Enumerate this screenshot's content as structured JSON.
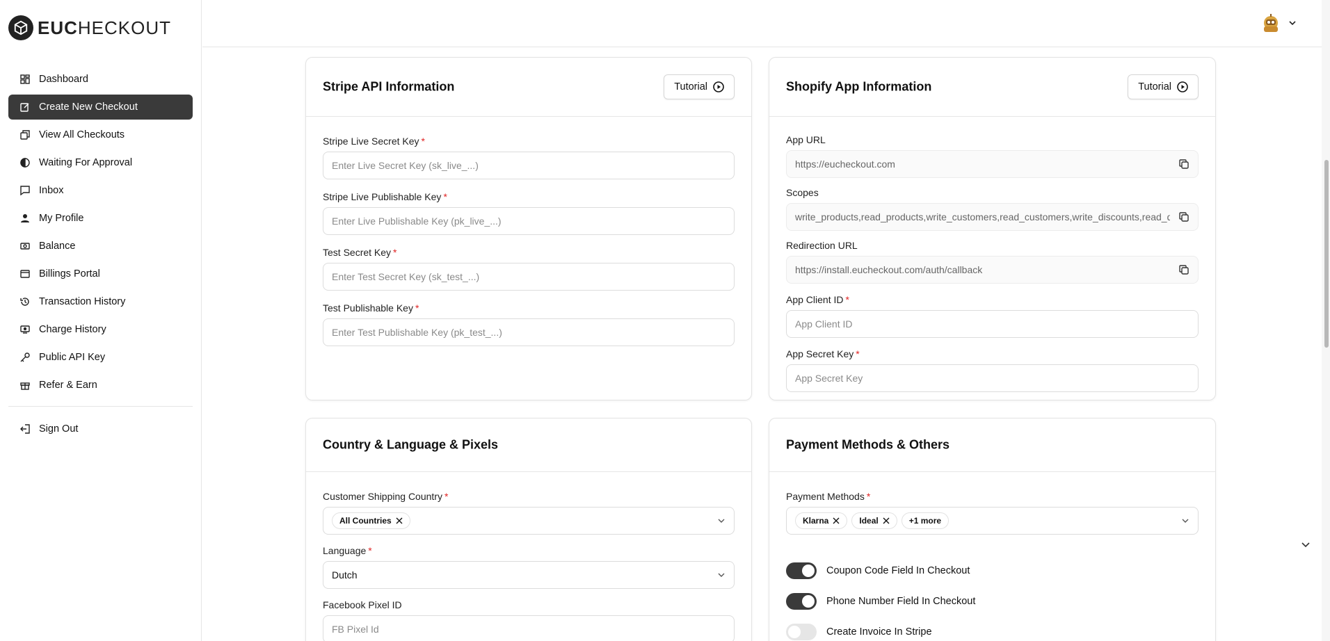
{
  "brand": {
    "logo_text_bold": "EUC",
    "logo_text_light": "HECKOUT"
  },
  "sidebar": {
    "items": [
      {
        "label": "Dashboard",
        "icon": "dashboard-icon"
      },
      {
        "label": "Create New Checkout",
        "icon": "edit-icon",
        "active": true
      },
      {
        "label": "View All Checkouts",
        "icon": "copy-icon"
      },
      {
        "label": "Waiting For Approval",
        "icon": "half-circle-icon"
      },
      {
        "label": "Inbox",
        "icon": "message-icon"
      },
      {
        "label": "My Profile",
        "icon": "user-icon"
      },
      {
        "label": "Balance",
        "icon": "banknote-icon"
      },
      {
        "label": "Billings Portal",
        "icon": "credit-card-icon"
      },
      {
        "label": "Transaction History",
        "icon": "history-icon"
      },
      {
        "label": "Charge History",
        "icon": "charge-icon"
      },
      {
        "label": "Public API Key",
        "icon": "key-icon"
      },
      {
        "label": "Refer & Earn",
        "icon": "gift-icon"
      }
    ],
    "sign_out": "Sign Out"
  },
  "stripe": {
    "title": "Stripe API Information",
    "tutorial": "Tutorial",
    "fields": [
      {
        "label": "Stripe Live Secret Key",
        "placeholder": "Enter Live Secret Key (sk_live_...)"
      },
      {
        "label": "Stripe Live Publishable Key",
        "placeholder": "Enter Live Publishable Key (pk_live_...)"
      },
      {
        "label": "Test Secret Key",
        "placeholder": "Enter Test Secret Key (sk_test_...)"
      },
      {
        "label": "Test Publishable Key",
        "placeholder": "Enter Test Publishable Key (pk_test_...)"
      }
    ]
  },
  "shopify": {
    "title": "Shopify App Information",
    "tutorial": "Tutorial",
    "app_url_label": "App URL",
    "app_url": "https://eucheckout.com",
    "scopes_label": "Scopes",
    "scopes": "write_products,read_products,write_customers,read_customers,write_discounts,read_discounts",
    "redirect_label": "Redirection URL",
    "redirect": "https://install.eucheckout.com/auth/callback",
    "client_id_label": "App Client ID",
    "client_id_placeholder": "App Client ID",
    "secret_label": "App Secret Key",
    "secret_placeholder": "App Secret Key"
  },
  "country": {
    "title": "Country & Language & Pixels",
    "shipping_label": "Customer Shipping Country",
    "shipping_chip": "All Countries",
    "language_label": "Language",
    "language_value": "Dutch",
    "fb_label": "Facebook Pixel ID",
    "fb_placeholder": "FB Pixel Id"
  },
  "payment": {
    "title": "Payment Methods & Others",
    "methods_label": "Payment Methods",
    "chips": [
      "Klarna",
      "Ideal"
    ],
    "more": "+1 more",
    "toggles": [
      {
        "label": "Coupon Code Field In Checkout",
        "on": true
      },
      {
        "label": "Phone Number Field In Checkout",
        "on": true
      },
      {
        "label": "Create Invoice In Stripe",
        "on": false
      }
    ]
  }
}
